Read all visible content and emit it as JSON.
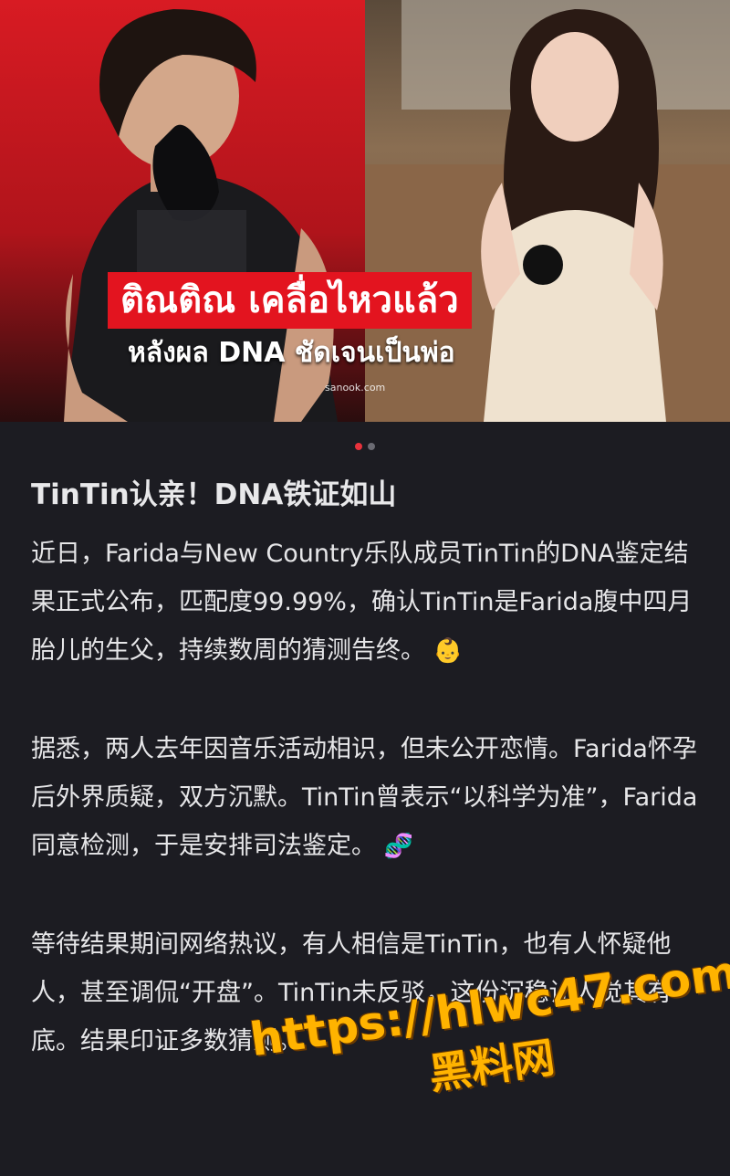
{
  "hero": {
    "caption_line1": "ติณติณ เคลื่อไหวแล้ว",
    "caption_line2": "หลังผล DNA ชัดเจนเป็นพ่อ",
    "watermark": "sanook.com",
    "active_dot_color": "#e8323c",
    "inactive_dot_color": "#6b6b73"
  },
  "article": {
    "title": "TinTin认亲！DNA铁证如山",
    "paragraphs": [
      {
        "text": "近日，Farida与New Country乐队成员TinTin的DNA鉴定结果正式公布，匹配度99.99%，确认TinTin是Farida腹中四月胎儿的生父，持续数周的猜测告终。",
        "emoji": "👶"
      },
      {
        "text": "据悉，两人去年因音乐活动相识，但未公开恋情。Farida怀孕后外界质疑，双方沉默。TinTin曾表示“以科学为准”，Farida同意检测，于是安排司法鉴定。",
        "emoji": "🧬"
      },
      {
        "text": "等待结果期间网络热议，有人相信是TinTin，也有人怀疑他人，甚至调侃“开盘”。TinTin未反驳，这份沉稳让人觉其有底。结果印证多数猜测。",
        "emoji": ""
      }
    ]
  },
  "watermark_overlay": {
    "url": "https://hlwc47.com",
    "name": "黑料网",
    "color": "#ffb300"
  }
}
